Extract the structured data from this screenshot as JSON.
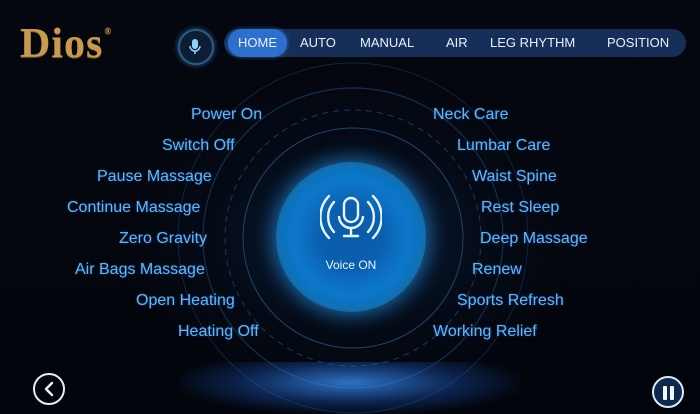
{
  "brand": {
    "logo_text": "Dios",
    "logo_mark": "®"
  },
  "nav": {
    "tabs": [
      {
        "label": "HOME",
        "active": true
      },
      {
        "label": "AUTO",
        "active": false
      },
      {
        "label": "MANUAL",
        "active": false
      },
      {
        "label": "AIR",
        "active": false
      },
      {
        "label": "LEG RHYTHM",
        "active": false
      },
      {
        "label": "POSITION",
        "active": false
      }
    ]
  },
  "voice": {
    "status_label": "Voice ON"
  },
  "commands_left": [
    "Power On",
    "Switch Off",
    "Pause Massage",
    "Continue Massage",
    "Zero Gravity",
    "Air  Bags Massage",
    "Open Heating",
    "Heating Off"
  ],
  "commands_right": [
    "Neck Care",
    "Lumbar Care",
    "Waist Spine",
    "Rest Sleep",
    "Deep Massage",
    "Renew",
    "Sports Refresh",
    "Working Relief"
  ],
  "icons": {
    "mic": "microphone-icon",
    "back": "chevron-left-icon",
    "pause": "pause-icon"
  },
  "colors": {
    "accent": "#2d6fcf",
    "command_text": "#5fb6ff",
    "logo": "#c89a4d",
    "background": "#03060d"
  }
}
